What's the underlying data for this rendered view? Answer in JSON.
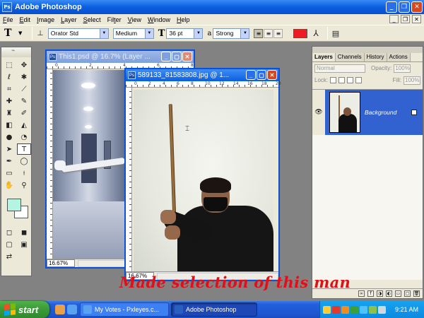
{
  "app": {
    "title": "Adobe Photoshop",
    "icon_label": "Ps"
  },
  "menu": {
    "items": [
      {
        "label": "File",
        "key": "F"
      },
      {
        "label": "Edit",
        "key": "E"
      },
      {
        "label": "Image",
        "key": "I"
      },
      {
        "label": "Layer",
        "key": "L"
      },
      {
        "label": "Select",
        "key": "S"
      },
      {
        "label": "Filter",
        "key": "t"
      },
      {
        "label": "View",
        "key": "V"
      },
      {
        "label": "Window",
        "key": "W"
      },
      {
        "label": "Help",
        "key": "H"
      }
    ]
  },
  "options_bar": {
    "tool_glyph": "T",
    "font_family": "Orator Std",
    "font_style": "Medium",
    "font_size": "36 pt",
    "aa_label": "a",
    "aa_method": "Strong",
    "text_color": "#ed1c24"
  },
  "documents": {
    "doc1": {
      "title": "This1.psd @ 16.7% (Layer ...",
      "zoom": "16.67%",
      "ruler": [
        "0",
        "2",
        "4",
        "6",
        "8"
      ]
    },
    "doc2": {
      "title": "589133_81583808.jpg @ 1...",
      "zoom": "16.67%",
      "ruler": [
        "0",
        "2",
        "4",
        "6",
        "8",
        "10",
        "12",
        "14",
        "16",
        "18",
        "20"
      ]
    }
  },
  "layers_panel": {
    "tabs": [
      "Layers",
      "Channels",
      "History",
      "Actions"
    ],
    "blend_mode": "Normal",
    "opacity_label": "Opacity:",
    "opacity_value": "100%",
    "lock_label": "Lock:",
    "fill_label": "Fill:",
    "fill_value": "100%",
    "layers": [
      {
        "name": "Background"
      }
    ]
  },
  "caption": "Made selection of this man",
  "taskbar": {
    "start_label": "start",
    "tasks": [
      {
        "label": "My Votes - Pxleyes.c...",
        "active": false
      },
      {
        "label": "Adobe Photoshop",
        "active": true
      }
    ],
    "clock": "9:21 AM"
  },
  "colors": {
    "foreground": "#b4f5e1",
    "background": "#ffffff",
    "caption": "#e0101a"
  }
}
